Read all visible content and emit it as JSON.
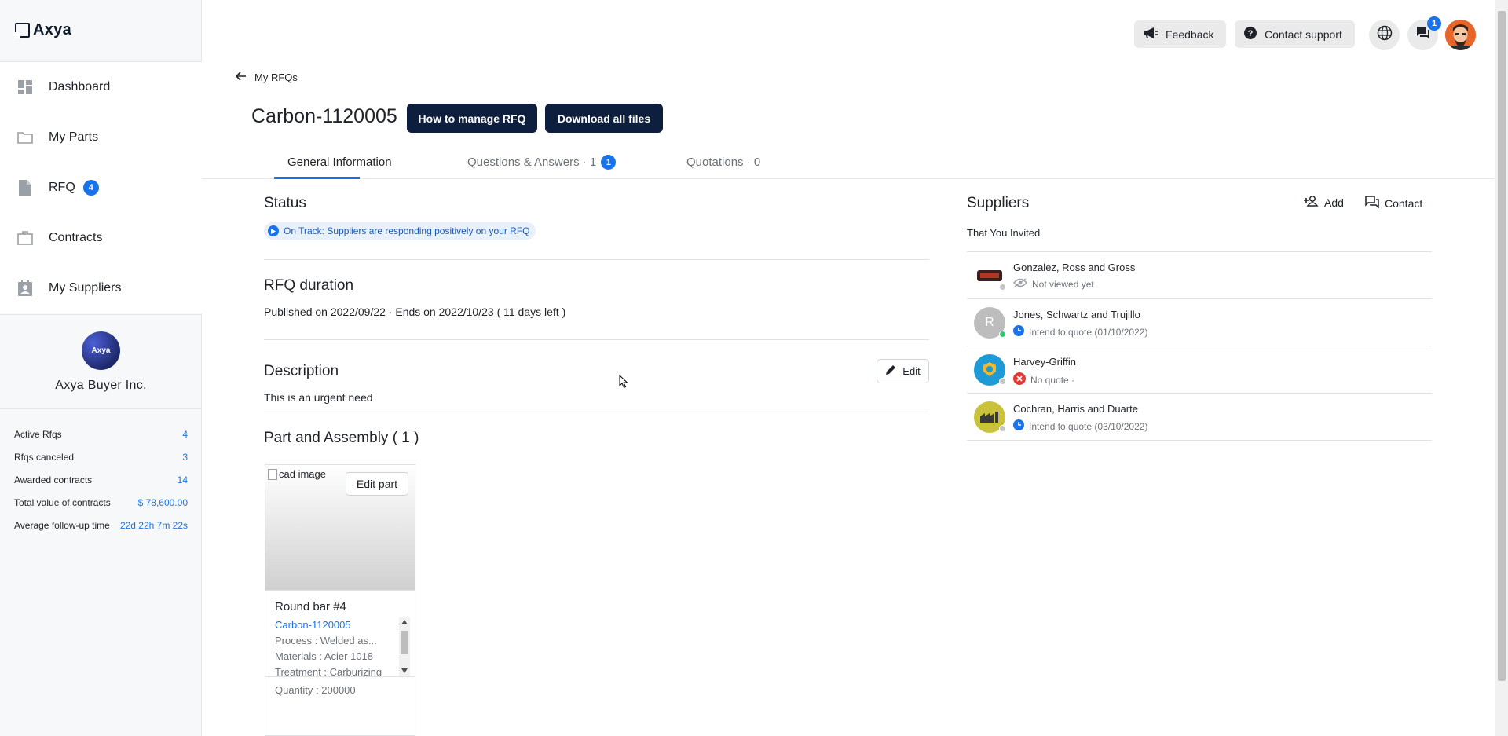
{
  "brand": {
    "logo_text": "Axya"
  },
  "sidebar": {
    "items": [
      {
        "label": "Dashboard",
        "icon": "dashboard-icon"
      },
      {
        "label": "My Parts",
        "icon": "folder-icon"
      },
      {
        "label": "RFQ",
        "icon": "document-icon",
        "badge": "4"
      },
      {
        "label": "Contracts",
        "icon": "briefcase-icon"
      },
      {
        "label": "My Suppliers",
        "icon": "contacts-icon"
      }
    ],
    "company": {
      "avatar_text": "Axya",
      "name": "Axya Buyer Inc."
    },
    "stats": [
      {
        "label": "Active Rfqs",
        "value": "4"
      },
      {
        "label": "Rfqs canceled",
        "value": "3"
      },
      {
        "label": "Awarded contracts",
        "value": "14"
      },
      {
        "label": "Total value of contracts",
        "value": "$ 78,600.00"
      },
      {
        "label": "Average follow-up time",
        "value": "22d 22h 7m 22s"
      }
    ]
  },
  "topbar": {
    "feedback_label": "Feedback",
    "support_label": "Contact support",
    "messages_badge": "1"
  },
  "header": {
    "back_label": "My RFQs",
    "title": "Carbon-1120005",
    "manage_button": "How to manage RFQ",
    "download_button": "Download all files"
  },
  "tabs": [
    {
      "label": "General Information"
    },
    {
      "label": "Questions & Answers · 1",
      "badge": "1"
    },
    {
      "label": "Quotations · 0"
    }
  ],
  "status": {
    "title": "Status",
    "chip": "On Track: Suppliers are responding positively on your RFQ"
  },
  "duration": {
    "title": "RFQ duration",
    "text": "Published on  2022/09/22 · Ends on 2022/10/23  ( 11 days left )"
  },
  "description": {
    "title": "Description",
    "edit_label": "Edit",
    "text": "This is an urgent need"
  },
  "parts": {
    "title": "Part and Assembly ( 1 )",
    "items": [
      {
        "image_alt": "cad image",
        "edit_label": "Edit part",
        "name": "Round bar #4",
        "rfq_link": "Carbon-1120005",
        "process": "Process : Welded as...",
        "materials": "Materials : Acier 1018",
        "treatment": "Treatment : Carburizing",
        "quantity": "Quantity : 200000"
      }
    ]
  },
  "suppliers": {
    "title": "Suppliers",
    "add_label": "Add",
    "contact_label": "Contact",
    "subtitle": "That You Invited",
    "list": [
      {
        "name": "Gonzalez, Ross and Gross",
        "status": "Not viewed yet",
        "avatar_text": "",
        "avatar_color": "#3a1f1f",
        "online": "#c4c4c4",
        "status_icon": "eye-off-icon"
      },
      {
        "name": "Jones, Schwartz and Trujillo",
        "status": "Intend to quote (01/10/2022)",
        "avatar_text": "R",
        "avatar_color": "#bdbdbd",
        "online": "#2ecc71",
        "status_icon": "clock-icon"
      },
      {
        "name": "Harvey-Griffin",
        "status": "No quote ·",
        "avatar_text": "",
        "avatar_color": "#1e9ad6",
        "online": "#c4c4c4",
        "status_icon": "x-circle-icon"
      },
      {
        "name": "Cochran, Harris and Duarte",
        "status": "Intend to quote (03/10/2022)",
        "avatar_text": "",
        "avatar_color": "#c9c23a",
        "online": "#c4c4c4",
        "status_icon": "clock-icon"
      }
    ]
  },
  "colors": {
    "accent": "#1a73e8",
    "dark_button": "#0d1f3c"
  }
}
